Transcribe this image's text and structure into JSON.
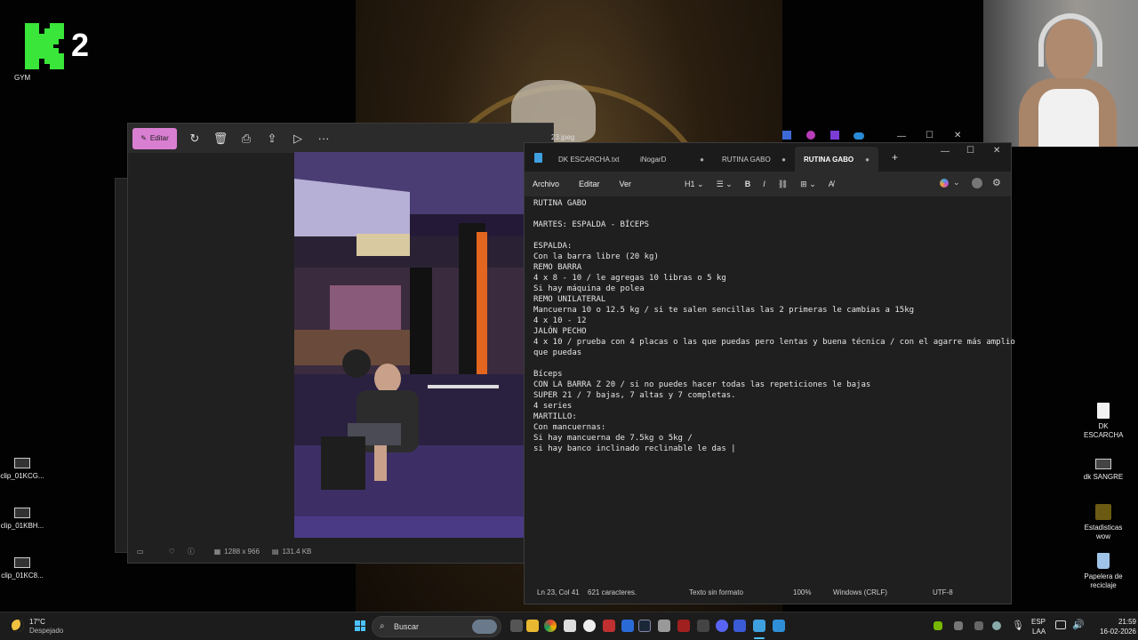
{
  "desktop": {
    "logo_text": "2",
    "logo_caption": "GYM",
    "icons_left": [
      {
        "label": "clip_01KCG..."
      },
      {
        "label": "clip_01KBH..."
      },
      {
        "label": "clip_01KC8..."
      }
    ],
    "icons_right": [
      {
        "label": "DK ESCARCHA"
      },
      {
        "label": "dk SANGRE"
      },
      {
        "label": "Estadisticas wow"
      },
      {
        "label": "Papelera de reciclaje"
      }
    ]
  },
  "photos": {
    "edit_label": "Editar",
    "title": "23.jpeg",
    "dimensions": "1288 x 966",
    "size": "131.4 KB"
  },
  "notepad": {
    "tabs": [
      {
        "label": "DK ESCARCHA.txt"
      },
      {
        "label": "iNogarD"
      },
      {
        "label": "RUTINA GABO"
      },
      {
        "label": "RUTINA GABO"
      }
    ],
    "menu": {
      "archivo": "Archivo",
      "editar": "Editar",
      "ver": "Ver"
    },
    "heading_level": "H1",
    "content": "RUTINA GABO\n\nMARTES: ESPALDA - BÍCEPS\n\nESPALDA:\nCon la barra libre (20 kg)\nREMO BARRA\n4 x 8 - 10 / le agregas 10 libras o 5 kg\nSi hay máquina de polea\nREMO UNILATERAL\nMancuerna 10 o 12.5 kg / si te salen sencillas las 2 primeras le cambias a 15kg\n4 x 10 - 12\nJALÓN PECHO\n4 x 10 / prueba con 4 placas o las que puedas pero lentas y buena técnica / con el agarre más amplio\nque puedas\n\nBíceps\nCON LA BARRA Z 20 / si no puedes hacer todas las repeticiones le bajas\nSUPER 21 / 7 bajas, 7 altas y 7 completas.\n4 series\nMARTILLO:\nCon mancuernas:\nSi hay mancuerna de 7.5kg o 5kg /\nsi hay banco inclinado reclinable le das |",
    "status": {
      "position": "Ln 23, Col 41",
      "chars": "621 caracteres.",
      "format": "Texto sin formato",
      "zoom": "100%",
      "eol": "Windows (CRLF)",
      "encoding": "UTF-8"
    }
  },
  "taskbar": {
    "weather_temp": "17°C",
    "weather_desc": "Despejado",
    "search_placeholder": "Buscar",
    "lang_top": "ESP",
    "lang_bottom": "LAA",
    "time": "21:59",
    "date": "16-02-2026"
  },
  "colors": {
    "accent_pink": "#d97fd2",
    "logo_green": "#39e639",
    "notepad_bg": "#1f1f1f",
    "taskbar_bg": "#1c1c1c"
  }
}
